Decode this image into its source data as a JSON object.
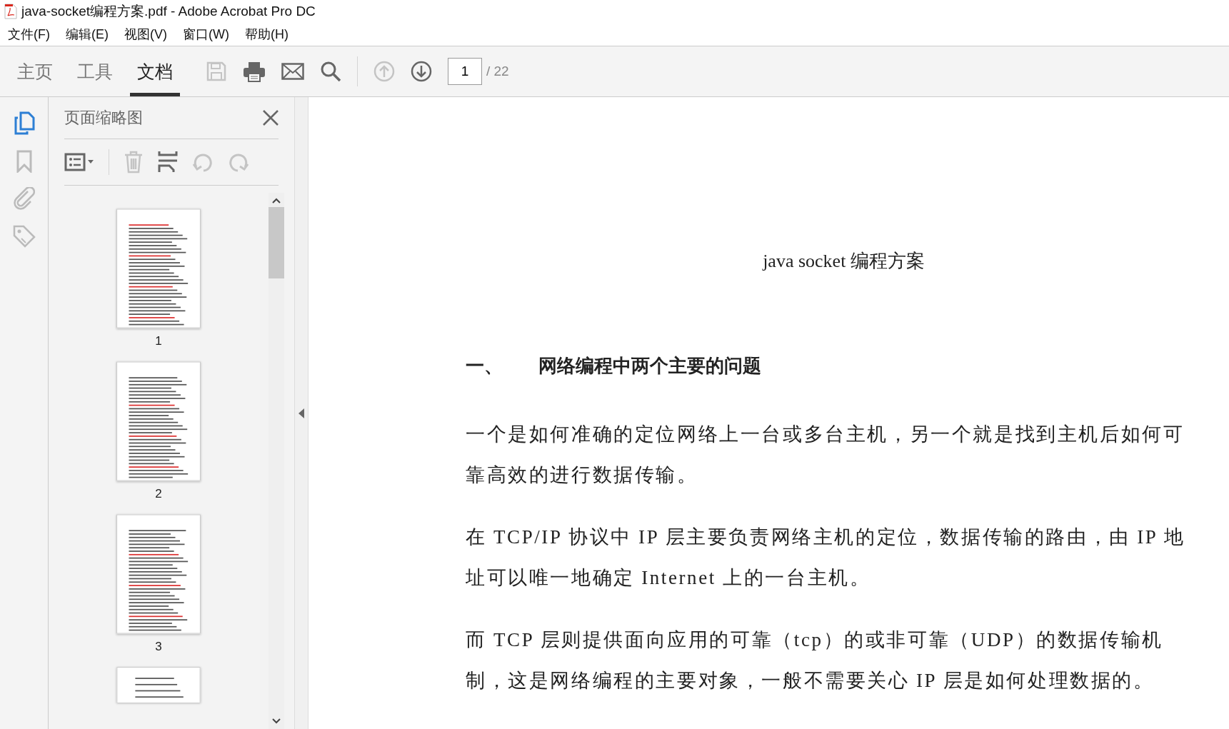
{
  "window": {
    "title": "java-socket编程方案.pdf - Adobe Acrobat Pro DC"
  },
  "menu": [
    "文件(F)",
    "编辑(E)",
    "视图(V)",
    "窗口(W)",
    "帮助(H)"
  ],
  "tabs": [
    {
      "label": "主页",
      "selected": false
    },
    {
      "label": "工具",
      "selected": false
    },
    {
      "label": "文档",
      "selected": true
    }
  ],
  "page_nav": {
    "value": "1",
    "total": "/ 22"
  },
  "side_panel": {
    "title": "页面缩略图",
    "thumbnails": [
      {
        "kind": "full",
        "label": "1"
      },
      {
        "kind": "full",
        "label": "2"
      },
      {
        "kind": "full",
        "label": "3"
      },
      {
        "kind": "cut"
      }
    ]
  },
  "document": {
    "title": "java socket 编程方案",
    "heading": {
      "number": "一、",
      "text": "网络编程中两个主要的问题"
    },
    "paragraphs": [
      "一个是如何准确的定位网络上一台或多台主机，另一个就是找到主机后如何可靠高效的进行数据传输。",
      "在 TCP/IP 协议中 IP 层主要负责网络主机的定位，数据传输的路由，由 IP 地址可以唯一地确定 Internet 上的一台主机。",
      "而 TCP 层则提供面向应用的可靠（tcp）的或非可靠（UDP）的数据传输机制，这是网络编程的主要对象，一般不需要关心 IP 层是如何处理数据的。"
    ]
  }
}
